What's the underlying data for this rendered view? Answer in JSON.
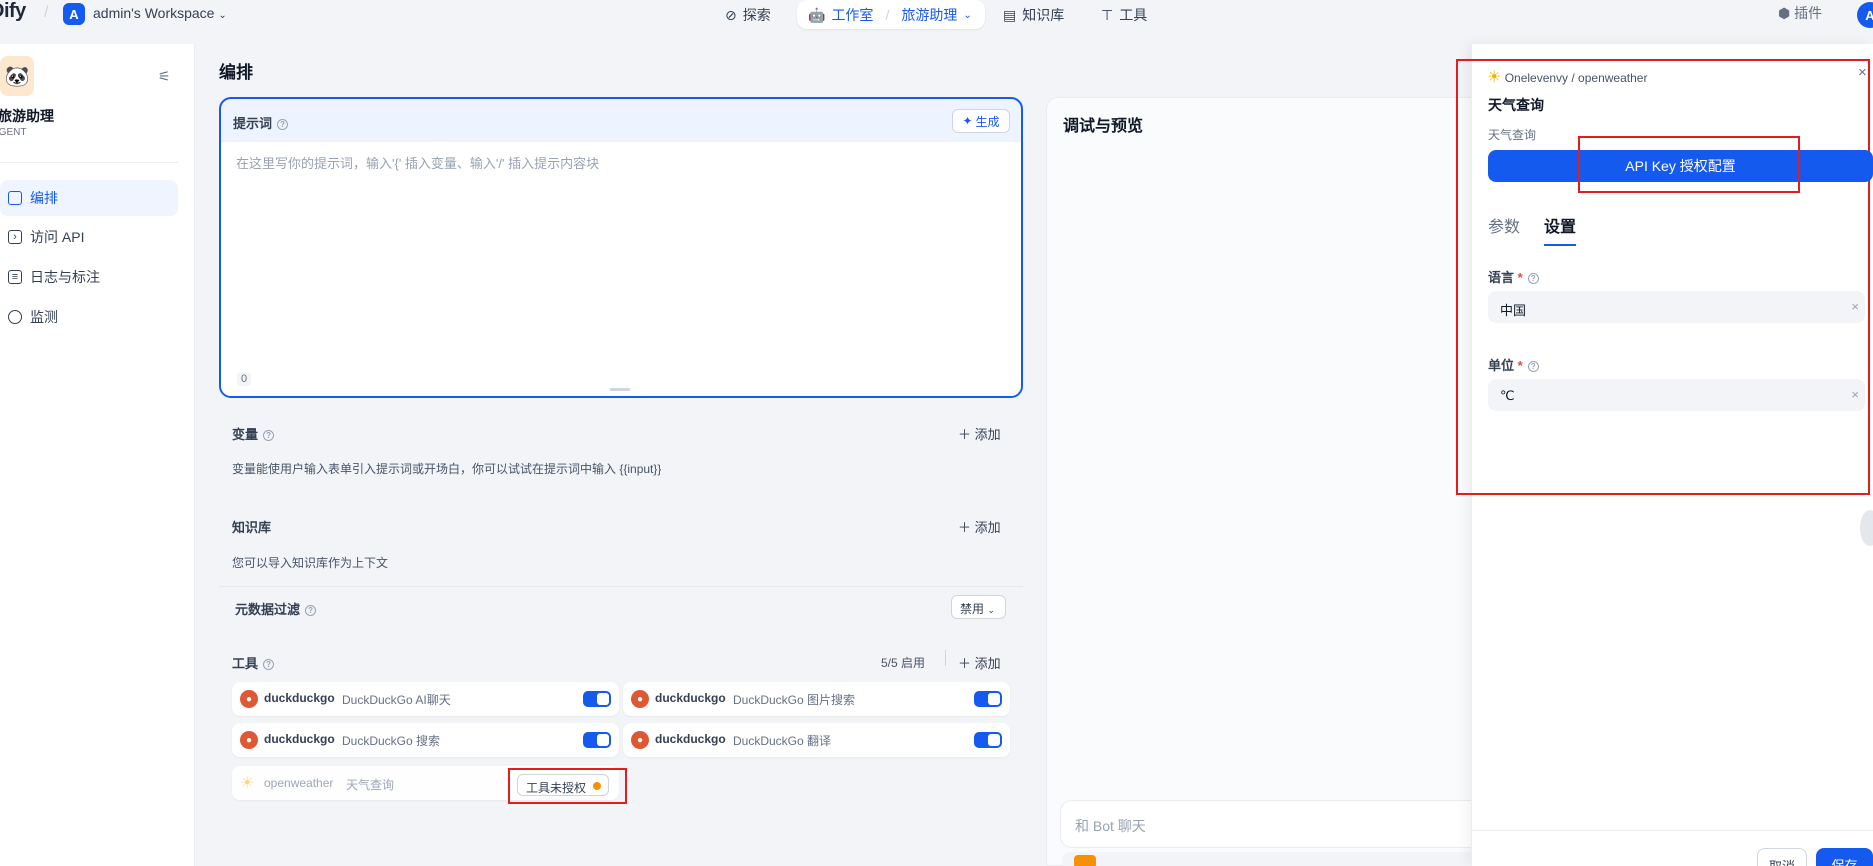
{
  "topbar": {
    "logo": "Dify",
    "workspace_badge": "A",
    "workspace_name": "admin's Workspace",
    "nav": {
      "explore": "探索",
      "studio": "工作室",
      "app": "旅游助理",
      "knowledge": "知识库",
      "tools": "工具"
    },
    "plugins": "插件",
    "avatar": "A"
  },
  "sidebar": {
    "app_name": "旅游助理",
    "app_type": "AGENT",
    "items": [
      {
        "label": "编排",
        "icon": "layout-icon",
        "active": true
      },
      {
        "label": "访问 API",
        "icon": "terminal-icon",
        "active": false
      },
      {
        "label": "日志与标注",
        "icon": "file-icon",
        "active": false
      },
      {
        "label": "监测",
        "icon": "gauge-icon",
        "active": false
      }
    ]
  },
  "main": {
    "title": "编排",
    "prompt": {
      "label": "提示词",
      "generate": "生成",
      "placeholder": "在这里写你的提示词，输入'{' 插入变量、输入'/' 插入提示内容块",
      "count": "0"
    },
    "variables": {
      "title": "变量",
      "add": "添加",
      "desc": "变量能使用户输入表单引入提示词或开场白，你可以试试在提示词中输入 {{input}}"
    },
    "knowledge": {
      "title": "知识库",
      "add": "添加",
      "desc": "您可以导入知识库作为上下文",
      "metadata_filter": "元数据过滤",
      "metadata_value": "禁用"
    },
    "tools": {
      "title": "工具",
      "enabled_count": "5/5 启用",
      "add": "添加",
      "items": [
        {
          "provider": "duckduckgo",
          "name": "DuckDuckGo AI聊天"
        },
        {
          "provider": "duckduckgo",
          "name": "DuckDuckGo 图片搜索"
        },
        {
          "provider": "duckduckgo",
          "name": "DuckDuckGo 搜索"
        },
        {
          "provider": "duckduckgo",
          "name": "DuckDuckGo 翻译"
        }
      ],
      "unauthorized": {
        "provider": "openweather",
        "name": "天气查询",
        "badge": "工具未授权"
      }
    }
  },
  "debug": {
    "title": "调试与预览",
    "chat_placeholder": "和 Bot 聊天"
  },
  "tool_panel": {
    "provider_path": "Onelevenvy / openweather",
    "tool_name": "天气查询",
    "tool_desc": "天气查询",
    "api_key_button": "API Key 授权配置",
    "tabs": {
      "params": "参数",
      "settings": "设置"
    },
    "fields": [
      {
        "label": "语言",
        "value": "中国"
      },
      {
        "label": "单位",
        "value": "℃"
      }
    ],
    "cancel": "取消",
    "save": "保存"
  },
  "colors": {
    "accent": "#155aef",
    "highlight_box": "#e11d1d",
    "duckduckgo": "#de5833",
    "warning_dot": "#f79009"
  }
}
